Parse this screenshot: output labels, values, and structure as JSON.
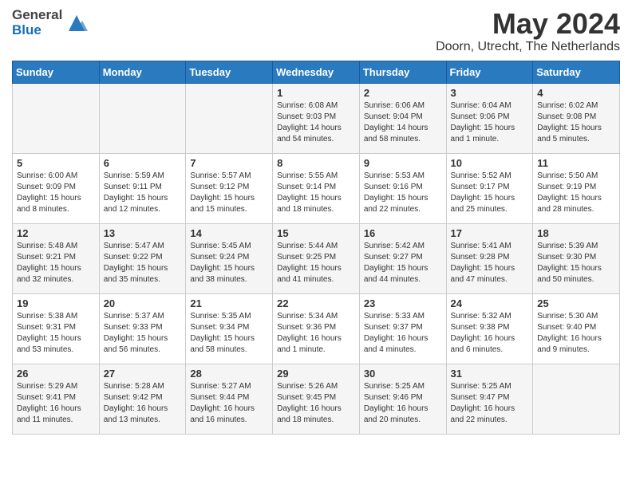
{
  "logo": {
    "general": "General",
    "blue": "Blue"
  },
  "title": "May 2024",
  "location": "Doorn, Utrecht, The Netherlands",
  "days_of_week": [
    "Sunday",
    "Monday",
    "Tuesday",
    "Wednesday",
    "Thursday",
    "Friday",
    "Saturday"
  ],
  "weeks": [
    [
      {
        "day": "",
        "info": ""
      },
      {
        "day": "",
        "info": ""
      },
      {
        "day": "",
        "info": ""
      },
      {
        "day": "1",
        "info": "Sunrise: 6:08 AM\nSunset: 9:03 PM\nDaylight: 14 hours and 54 minutes."
      },
      {
        "day": "2",
        "info": "Sunrise: 6:06 AM\nSunset: 9:04 PM\nDaylight: 14 hours and 58 minutes."
      },
      {
        "day": "3",
        "info": "Sunrise: 6:04 AM\nSunset: 9:06 PM\nDaylight: 15 hours and 1 minute."
      },
      {
        "day": "4",
        "info": "Sunrise: 6:02 AM\nSunset: 9:08 PM\nDaylight: 15 hours and 5 minutes."
      }
    ],
    [
      {
        "day": "5",
        "info": "Sunrise: 6:00 AM\nSunset: 9:09 PM\nDaylight: 15 hours and 8 minutes."
      },
      {
        "day": "6",
        "info": "Sunrise: 5:59 AM\nSunset: 9:11 PM\nDaylight: 15 hours and 12 minutes."
      },
      {
        "day": "7",
        "info": "Sunrise: 5:57 AM\nSunset: 9:12 PM\nDaylight: 15 hours and 15 minutes."
      },
      {
        "day": "8",
        "info": "Sunrise: 5:55 AM\nSunset: 9:14 PM\nDaylight: 15 hours and 18 minutes."
      },
      {
        "day": "9",
        "info": "Sunrise: 5:53 AM\nSunset: 9:16 PM\nDaylight: 15 hours and 22 minutes."
      },
      {
        "day": "10",
        "info": "Sunrise: 5:52 AM\nSunset: 9:17 PM\nDaylight: 15 hours and 25 minutes."
      },
      {
        "day": "11",
        "info": "Sunrise: 5:50 AM\nSunset: 9:19 PM\nDaylight: 15 hours and 28 minutes."
      }
    ],
    [
      {
        "day": "12",
        "info": "Sunrise: 5:48 AM\nSunset: 9:21 PM\nDaylight: 15 hours and 32 minutes."
      },
      {
        "day": "13",
        "info": "Sunrise: 5:47 AM\nSunset: 9:22 PM\nDaylight: 15 hours and 35 minutes."
      },
      {
        "day": "14",
        "info": "Sunrise: 5:45 AM\nSunset: 9:24 PM\nDaylight: 15 hours and 38 minutes."
      },
      {
        "day": "15",
        "info": "Sunrise: 5:44 AM\nSunset: 9:25 PM\nDaylight: 15 hours and 41 minutes."
      },
      {
        "day": "16",
        "info": "Sunrise: 5:42 AM\nSunset: 9:27 PM\nDaylight: 15 hours and 44 minutes."
      },
      {
        "day": "17",
        "info": "Sunrise: 5:41 AM\nSunset: 9:28 PM\nDaylight: 15 hours and 47 minutes."
      },
      {
        "day": "18",
        "info": "Sunrise: 5:39 AM\nSunset: 9:30 PM\nDaylight: 15 hours and 50 minutes."
      }
    ],
    [
      {
        "day": "19",
        "info": "Sunrise: 5:38 AM\nSunset: 9:31 PM\nDaylight: 15 hours and 53 minutes."
      },
      {
        "day": "20",
        "info": "Sunrise: 5:37 AM\nSunset: 9:33 PM\nDaylight: 15 hours and 56 minutes."
      },
      {
        "day": "21",
        "info": "Sunrise: 5:35 AM\nSunset: 9:34 PM\nDaylight: 15 hours and 58 minutes."
      },
      {
        "day": "22",
        "info": "Sunrise: 5:34 AM\nSunset: 9:36 PM\nDaylight: 16 hours and 1 minute."
      },
      {
        "day": "23",
        "info": "Sunrise: 5:33 AM\nSunset: 9:37 PM\nDaylight: 16 hours and 4 minutes."
      },
      {
        "day": "24",
        "info": "Sunrise: 5:32 AM\nSunset: 9:38 PM\nDaylight: 16 hours and 6 minutes."
      },
      {
        "day": "25",
        "info": "Sunrise: 5:30 AM\nSunset: 9:40 PM\nDaylight: 16 hours and 9 minutes."
      }
    ],
    [
      {
        "day": "26",
        "info": "Sunrise: 5:29 AM\nSunset: 9:41 PM\nDaylight: 16 hours and 11 minutes."
      },
      {
        "day": "27",
        "info": "Sunrise: 5:28 AM\nSunset: 9:42 PM\nDaylight: 16 hours and 13 minutes."
      },
      {
        "day": "28",
        "info": "Sunrise: 5:27 AM\nSunset: 9:44 PM\nDaylight: 16 hours and 16 minutes."
      },
      {
        "day": "29",
        "info": "Sunrise: 5:26 AM\nSunset: 9:45 PM\nDaylight: 16 hours and 18 minutes."
      },
      {
        "day": "30",
        "info": "Sunrise: 5:25 AM\nSunset: 9:46 PM\nDaylight: 16 hours and 20 minutes."
      },
      {
        "day": "31",
        "info": "Sunrise: 5:25 AM\nSunset: 9:47 PM\nDaylight: 16 hours and 22 minutes."
      },
      {
        "day": "",
        "info": ""
      }
    ]
  ]
}
